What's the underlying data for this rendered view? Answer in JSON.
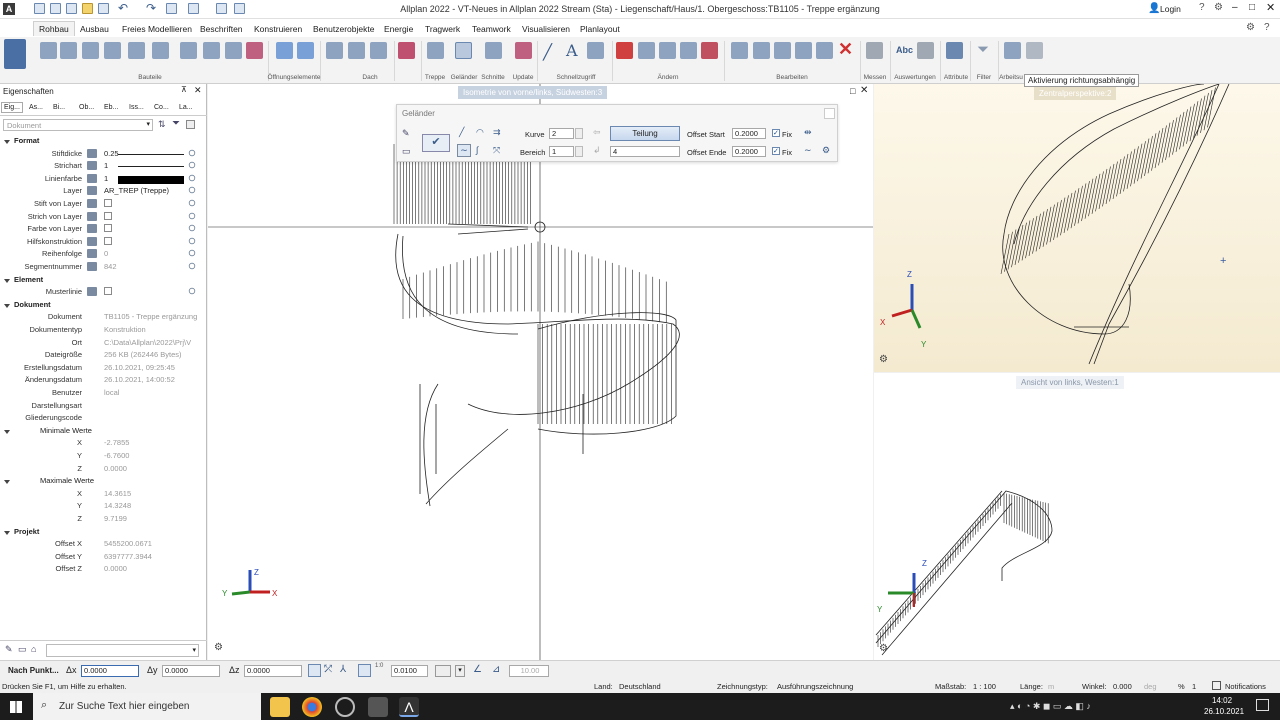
{
  "window": {
    "title": "Allplan 2022 - VT-Neues in Allplan 2022 Stream (Sta) - Liegenschaft/Haus/1. Obergeschoss:TB1105 - Treppe ergänzung",
    "login": "Login"
  },
  "menu": {
    "tabs": [
      "Rohbau",
      "Ausbau",
      "Freies Modellieren",
      "Beschriften",
      "Konstruieren",
      "Benutzerobjekte",
      "Energie",
      "Tragwerk",
      "Teamwork",
      "Visualisieren",
      "Planlayout"
    ],
    "active": "Rohbau"
  },
  "ribbon": {
    "groups": [
      "Bauteile",
      "Öffnungselemente",
      "Dach",
      "Treppe",
      "Geländer",
      "Schnitte",
      "Update",
      "Schnellzugriff",
      "Ändern",
      "Bearbeiten",
      "Messen",
      "Auswertungen",
      "Attribute",
      "Filter",
      "Arbeitsu"
    ]
  },
  "tooltip": "Aktivierung richtungsabhängig",
  "props": {
    "title": "Eigenschaften",
    "tabs": [
      "Eig...",
      "As...",
      "Bi...",
      "Ob...",
      "Eb...",
      "Iss...",
      "Co...",
      "La..."
    ],
    "filter_value": "Dokument",
    "format_header": "Format",
    "format": [
      {
        "label": "Stiftdicke",
        "value": "0.25"
      },
      {
        "label": "Strichart",
        "value": "1"
      },
      {
        "label": "Linienfarbe",
        "value": "1"
      },
      {
        "label": "Layer",
        "value": "AR_TREP (Treppe)"
      },
      {
        "label": "Stift von Layer",
        "value": ""
      },
      {
        "label": "Strich von Layer",
        "value": ""
      },
      {
        "label": "Farbe von Layer",
        "value": ""
      },
      {
        "label": "Hilfskonstruktion",
        "value": ""
      },
      {
        "label": "Reihenfolge",
        "value": "0"
      },
      {
        "label": "Segmentnummer",
        "value": "842"
      }
    ],
    "element_header": "Element",
    "musterlinie": "Musterlinie",
    "dokument_header": "Dokument",
    "dokument": [
      {
        "label": "Dokument",
        "value": "TB1105 - Treppe ergänzung"
      },
      {
        "label": "Dokumententyp",
        "value": "Konstruktion"
      },
      {
        "label": "Ort",
        "value": "C:\\Data\\Allplan\\2022\\Prj\\V"
      },
      {
        "label": "Dateigröße",
        "value": "256 KB (262446 Bytes)"
      },
      {
        "label": "Erstellungsdatum",
        "value": "26.10.2021, 09:25:45"
      },
      {
        "label": "Änderungsdatum",
        "value": "26.10.2021, 14:00:52"
      },
      {
        "label": "Benutzer",
        "value": "local"
      },
      {
        "label": "Darstellungsart",
        "value": ""
      },
      {
        "label": "Gliederungscode",
        "value": ""
      }
    ],
    "min_header": "Minimale Werte",
    "min": [
      {
        "label": "X",
        "value": "-2.7855"
      },
      {
        "label": "Y",
        "value": "-6.7600"
      },
      {
        "label": "Z",
        "value": "0.0000"
      }
    ],
    "max_header": "Maximale Werte",
    "max": [
      {
        "label": "X",
        "value": "14.3615"
      },
      {
        "label": "Y",
        "value": "14.3248"
      },
      {
        "label": "Z",
        "value": "9.7199"
      }
    ],
    "projekt_header": "Projekt",
    "projekt": [
      {
        "label": "Offset X",
        "value": "5455200.0671"
      },
      {
        "label": "Offset Y",
        "value": "6397777.3944"
      },
      {
        "label": "Offset Z",
        "value": "0.0000"
      }
    ]
  },
  "views": {
    "v1": "Isometrie von vorne/links, Südwesten:3",
    "v2": "Zentralperspektive:2",
    "v3": "Ansicht von links, Westen:1"
  },
  "gelaender": {
    "title": "Geländer",
    "kurve_label": "Kurve",
    "kurve": "2",
    "bereich_label": "Bereich",
    "bereich": "1",
    "teilung": "Teilung",
    "teilung_value": "4",
    "offset_start_label": "Offset Start",
    "offset_start": "0.2000",
    "offset_ende_label": "Offset Ende",
    "offset_ende": "0.2000",
    "fix": "Fix"
  },
  "statusrow": {
    "mode": "Nach Punkt...",
    "dx_label": "Δx",
    "dx": "0.0000",
    "dy_label": "Δy",
    "dy": "0.0000",
    "dz_label": "Δz",
    "dz": "0.0000",
    "grid": "0.0100",
    "angle": "10.00"
  },
  "hint": {
    "text": "Drücken Sie F1, um Hilfe zu erhalten.",
    "land_label": "Land:",
    "land": "Deutschland",
    "zt_label": "Zeichnungstyp:",
    "zt": "Ausführungszeichnung",
    "mass_label": "Maßstab:",
    "mass": "1 : 100",
    "laenge_label": "Länge:",
    "laenge": "m",
    "winkel_label": "Winkel:",
    "winkel": "0.000",
    "deg": "deg",
    "pct": "%",
    "pct_val": "1",
    "notif": "Notifications"
  },
  "taskbar": {
    "search": "Zur Suche Text hier eingeben",
    "time": "14:02",
    "date": "26.10.2021"
  },
  "axes": {
    "x": "X",
    "y": "Y",
    "z": "Z"
  }
}
